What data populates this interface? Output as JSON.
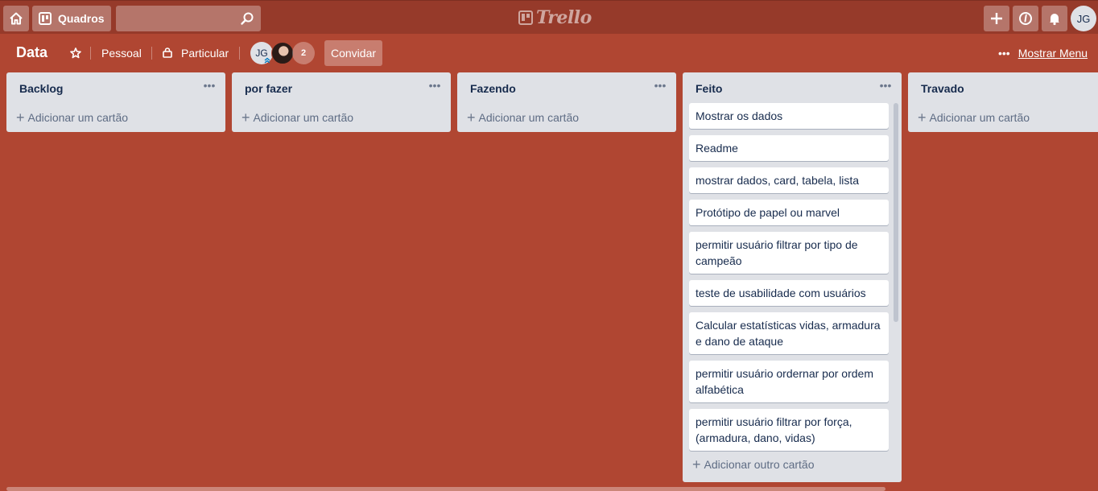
{
  "header": {
    "boards_label": "Quadros",
    "search_placeholder": "",
    "logo_text": "Trello",
    "avatar_initials": "JG"
  },
  "board": {
    "title": "Data",
    "team": "Pessoal",
    "visibility": "Particular",
    "member_initials": "JG",
    "extra_members": "2",
    "invite_label": "Convidar",
    "menu_label": "Mostrar Menu",
    "background_color": "#b04632"
  },
  "lists": [
    {
      "title": "Backlog",
      "add_label": "Adicionar um cartão"
    },
    {
      "title": "por fazer",
      "add_label": "Adicionar um cartão"
    },
    {
      "title": "Fazendo",
      "add_label": "Adicionar um cartão"
    },
    {
      "title": "Feito",
      "add_label": "Adicionar outro cartão",
      "cards": [
        "Mostrar os dados",
        "Readme",
        "mostrar dados, card, tabela, lista",
        "Protótipo de papel ou marvel",
        "permitir usuário filtrar por tipo de campeão",
        "teste de usabilidade com usuários",
        "Calcular estatísticas vidas, armadura e dano de ataque",
        "permitir usuário ordernar por ordem alfabética",
        "permitir usuário filtrar por força, (armadura, dano, vidas)"
      ]
    },
    {
      "title": "Travado",
      "add_label": "Adicionar um cartão"
    }
  ]
}
